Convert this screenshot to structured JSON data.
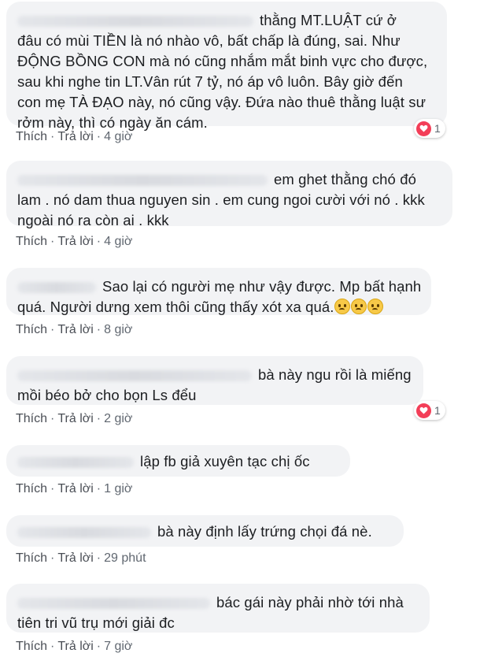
{
  "comments": [
    {
      "lines": [
        "thằng MT.LUẬT cứ ở",
        "đâu có mùi TIỀN là nó nhào vô, bất chấp là đúng, sai. Như",
        "ĐỘNG BỒNG CON mà nó cũng nhắm mắt binh vực cho được,",
        "sau khi nghe tin LT.Vân rút 7 tỷ, nó áp vô luôn. Bây giờ đến",
        "con mẹ TÀ ĐẠO này, nó cũng vậy. Đứa nào thuê thằng luật sư",
        "rởm này, thì có ngày ăn cám."
      ],
      "like": "Thích",
      "reply": "Trả lời",
      "time": "4 giờ",
      "reaction": {
        "type": "heart-icon",
        "count": "1"
      }
    },
    {
      "lines": [
        "em ghet thằng chó đó",
        "lam . nó dam thua nguyen sin . em cung ngoi cười với nó . kkk",
        "ngoài nó ra còn ai . kkk"
      ],
      "like": "Thích",
      "reply": "Trả lời",
      "time": "4 giờ"
    },
    {
      "lines": [
        "Sao lại có người mẹ như vậy được. Mp bất hạnh",
        "quá. Người dưng xem thôi cũng thấy xót xa quá."
      ],
      "emoji": [
        "sad-face-emoji",
        "sad-face-emoji",
        "sad-face-emoji"
      ],
      "like": "Thích",
      "reply": "Trả lời",
      "time": "8 giờ"
    },
    {
      "lines": [
        "bà này ngu rồi là miếng",
        "mồi béo bở cho bọn Ls đểu"
      ],
      "like": "Thích",
      "reply": "Trả lời",
      "time": "2 giờ",
      "reaction": {
        "type": "heart-icon",
        "count": "1"
      }
    },
    {
      "lines": [
        "lập fb giả xuyên tạc chị ốc"
      ],
      "like": "Thích",
      "reply": "Trả lời",
      "time": "1 giờ"
    },
    {
      "lines": [
        "bà này định lấy trứng chọi đá nè."
      ],
      "like": "Thích",
      "reply": "Trả lời",
      "time": "29 phút"
    },
    {
      "lines": [
        "bác gái này phải nhờ tới nhà",
        "tiên tri vũ trụ mới giải đc"
      ],
      "like": "Thích",
      "reply": "Trả lời",
      "time": "7 giờ"
    }
  ],
  "colors": {
    "bubble": "#f2f3f5",
    "text": "#1c1e21",
    "meta": "#606770",
    "heart": "#f33e58"
  }
}
